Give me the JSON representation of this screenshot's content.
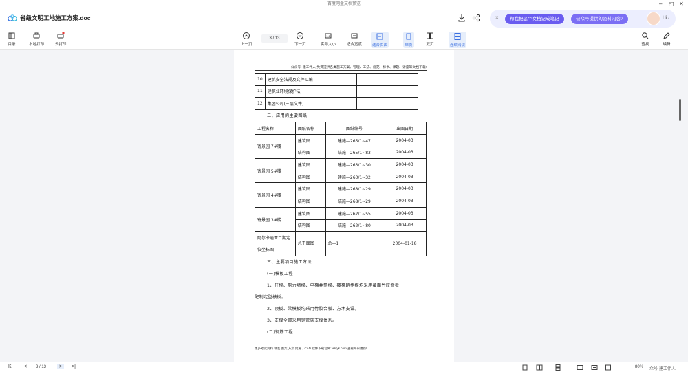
{
  "window": {
    "title": "百度网盘文档预览",
    "minimize": "–",
    "restore": "◱",
    "close": "✕"
  },
  "doc": {
    "title": "省级文明工地施工方案.doc"
  },
  "ai": {
    "close": "×",
    "chip1": "帮我把这个文档记成笔记",
    "chip2": "公众号提供的资料内容?",
    "hi": "Hi ›"
  },
  "toolbar": {
    "catalog": "目录",
    "local_print": "本地打印",
    "cloud_print": "云打印",
    "prev": "上一页",
    "page": "3 / 13",
    "next": "下一页",
    "actual": "实际大小",
    "fit_width": "适合宽度",
    "fit_page": "适合页面",
    "single": "单页",
    "double": "双页",
    "continuous": "连续阅读",
    "search": "查找",
    "edit": "编辑"
  },
  "page": {
    "header": "公众号: 建工伴人 免费提供各类施工方案、管理、工法、规范、标书、课题、讲座等文档下载!",
    "table1": [
      [
        "10",
        "建筑安全法规及文件汇编",
        "",
        ""
      ],
      [
        "11",
        "建筑业环境保护法",
        "",
        ""
      ],
      [
        "12",
        "集团公司(三层文件)",
        "",
        ""
      ]
    ],
    "section2": "二、应用的主要图纸",
    "table2_headers": [
      "工程名称",
      "图纸名称",
      "图纸编号",
      "出图日期"
    ],
    "table2_groups": [
      {
        "name": "寄景园 7#楼",
        "rows": [
          [
            "建筑图",
            "建施—265/1~47",
            "2004-03"
          ],
          [
            "结构图",
            "结施—265/1~83",
            "2004-03"
          ]
        ]
      },
      {
        "name": "寄景园 5#楼",
        "rows": [
          [
            "建筑图",
            "建施—263/1~30",
            "2004-03"
          ],
          [
            "结构图",
            "建施—263/1~32",
            "2004-03"
          ]
        ]
      },
      {
        "name": "寄景园 4#楼",
        "rows": [
          [
            "建筑图",
            "建施—268/1~29",
            "2004-03"
          ],
          [
            "结构图",
            "结施—268/1~29",
            "2004-03"
          ]
        ]
      },
      {
        "name": "寄景园 3#楼",
        "rows": [
          [
            "建筑图",
            "建施—262/1~55",
            "2004-03"
          ],
          [
            "结构图",
            "结施—262/1~80",
            "2004-03"
          ]
        ]
      }
    ],
    "table2_last": {
      "name": "阿尔卡迪亚二期定位坐标图",
      "drawing": "总平面图",
      "code": "总—1",
      "date": "2004-01-18"
    },
    "section3": "三、主要项目施工方法",
    "sub1": "(一)模板工程",
    "p1": "1、柱模、剪力墙模、电梯井筒模、楼梯踏步模均采用覆面竹胶合板",
    "p1b": "配制定型模板。",
    "p2": "2、顶板、梁模板均采用竹胶合板、方木支设。",
    "p3": "3、支撑全部采用钢管架支撑体系。",
    "sub2": "(二)钢筋工程",
    "footer": "更多考试资料 精准 图案 方案 措施、CAD 软件下载官网: wkfyk.com 查看每日更新!"
  },
  "status": {
    "first": "K",
    "prev": "<",
    "page": "3 / 13",
    "next": ">",
    "last": ">|",
    "zoom_minus": "−",
    "zoom": "80%",
    "zoom_plus": "+",
    "watermark": "众号·建工伴人"
  }
}
